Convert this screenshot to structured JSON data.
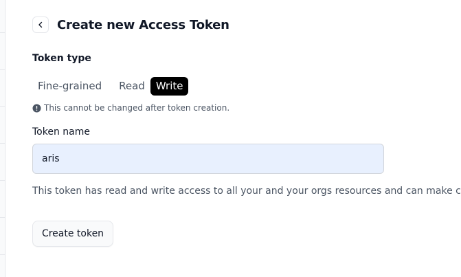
{
  "header": {
    "back_icon": "chevron-left-icon",
    "title": "Create new Access Token"
  },
  "token_type": {
    "label": "Token type",
    "options": [
      {
        "label": "Fine-grained",
        "selected": false
      },
      {
        "label": "Read",
        "selected": false
      },
      {
        "label": "Write",
        "selected": true
      }
    ],
    "note_icon": "info-icon",
    "note": "This cannot be changed after token creation."
  },
  "token_name": {
    "label": "Token name",
    "value": "aris"
  },
  "description": "This token has read and write access to all your and your orgs resources and can make calls to",
  "actions": {
    "create_label": "Create token"
  },
  "colors": {
    "accent": "#000000",
    "input_background": "#e8f0fe",
    "muted_text": "#4b5563"
  }
}
